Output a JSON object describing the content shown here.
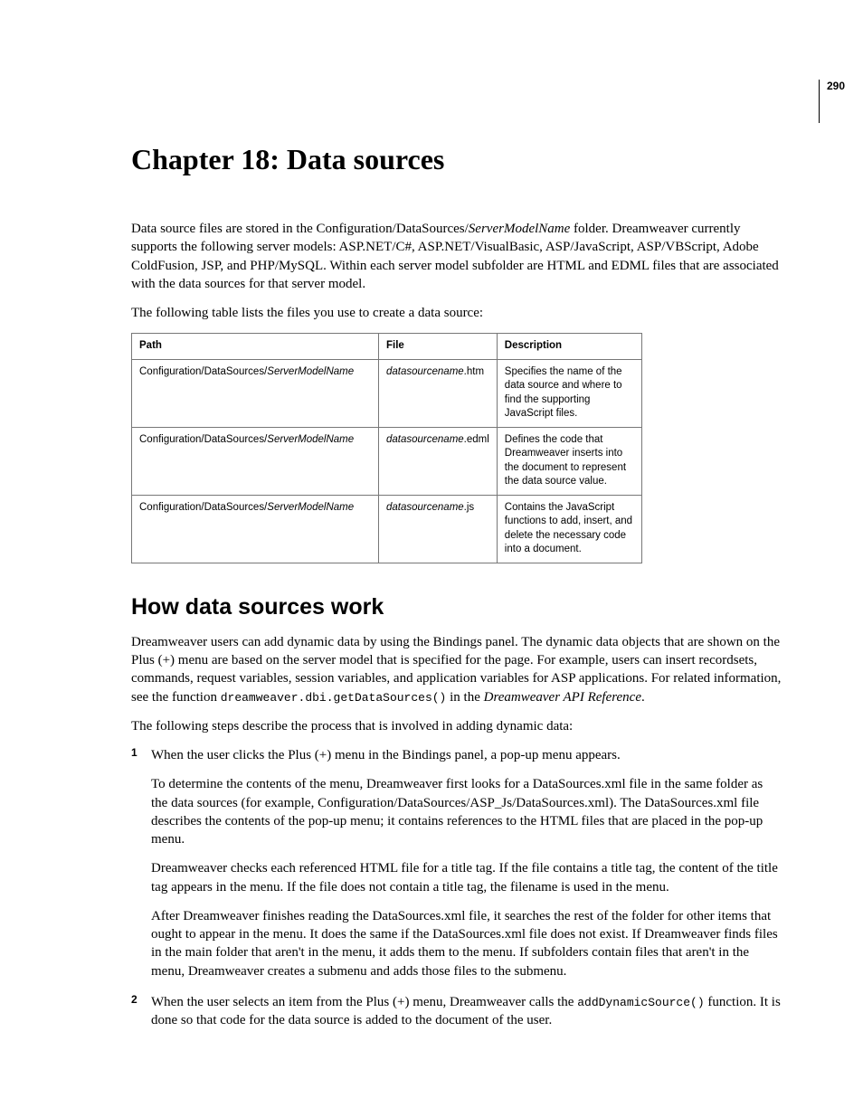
{
  "page_number": "290",
  "chapter_title": "Chapter 18: Data sources",
  "intro_p1_pre": "Data source files are stored in the Configuration/DataSources/",
  "intro_p1_italic": "ServerModelName",
  "intro_p1_post": " folder. Dreamweaver currently supports the following server models: ASP.NET/C#, ASP.NET/VisualBasic, ASP/JavaScript, ASP/VBScript, Adobe ColdFusion, JSP, and PHP/MySQL. Within each server model subfolder are HTML and EDML files that are associated with the data sources for that server model.",
  "intro_p2": "The following table lists the files you use to create a data source:",
  "table": {
    "headers": {
      "c1": "Path",
      "c2": "File",
      "c3": "Description"
    },
    "rows": [
      {
        "path_pre": "Configuration/DataSources/",
        "path_italic": "ServerModelName",
        "file_italic": "datasourcename",
        "file_ext": ".htm",
        "desc": "Specifies the name of the data source and where to find the supporting JavaScript files."
      },
      {
        "path_pre": "Configuration/DataSources/",
        "path_italic": "ServerModelName",
        "file_italic": "datasourcename",
        "file_ext": ".edml",
        "desc": "Defines the code that Dreamweaver inserts into the document to represent the data source value."
      },
      {
        "path_pre": "Configuration/DataSources/",
        "path_italic": "ServerModelName",
        "file_italic": "datasourcename",
        "file_ext": ".js",
        "desc": "Contains the JavaScript functions to add, insert, and delete the necessary code into a document."
      }
    ]
  },
  "section_heading": "How data sources work",
  "sec_p1_pre": "Dreamweaver users can add dynamic data by using the Bindings panel. The dynamic data objects that are shown on the Plus (+) menu are based on the server model that is specified for the page. For example, users can insert recordsets, commands, request variables, session variables, and application variables for ASP applications. For related information, see the function ",
  "sec_p1_code": "dreamweaver.dbi.getDataSources()",
  "sec_p1_mid": " in the ",
  "sec_p1_italic": "Dreamweaver API Reference",
  "sec_p1_post": ".",
  "sec_p2": "The following steps describe the process that is involved in adding dynamic data:",
  "steps": {
    "s1": {
      "p1": "When the user clicks the Plus (+) menu in the Bindings panel, a pop-up menu appears.",
      "p2": "To determine the contents of the menu, Dreamweaver first looks for a DataSources.xml file in the same folder as the data sources (for example, Configuration/DataSources/ASP_Js/DataSources.xml). The DataSources.xml file describes the contents of the pop-up menu; it contains references to the HTML files that are placed in the pop-up menu.",
      "p3": "Dreamweaver checks each referenced HTML file for a title tag. If the file contains a title tag, the content of the title tag appears in the menu. If the file does not contain a title tag, the filename is used in the menu.",
      "p4": "After Dreamweaver finishes reading the DataSources.xml file, it searches the rest of the folder for other items that ought to appear in the menu. It does the same if the DataSources.xml file does not exist. If Dreamweaver finds files in the main folder that aren't in the menu, it adds them to the menu. If subfolders contain files that aren't in the menu, Dreamweaver creates a submenu and adds those files to the submenu."
    },
    "s2": {
      "p1_pre": "When the user selects an item from the Plus (+) menu, Dreamweaver calls the ",
      "p1_code": "addDynamicSource()",
      "p1_post": " function. It is done so that code for the data source is added to the document of the user."
    }
  }
}
